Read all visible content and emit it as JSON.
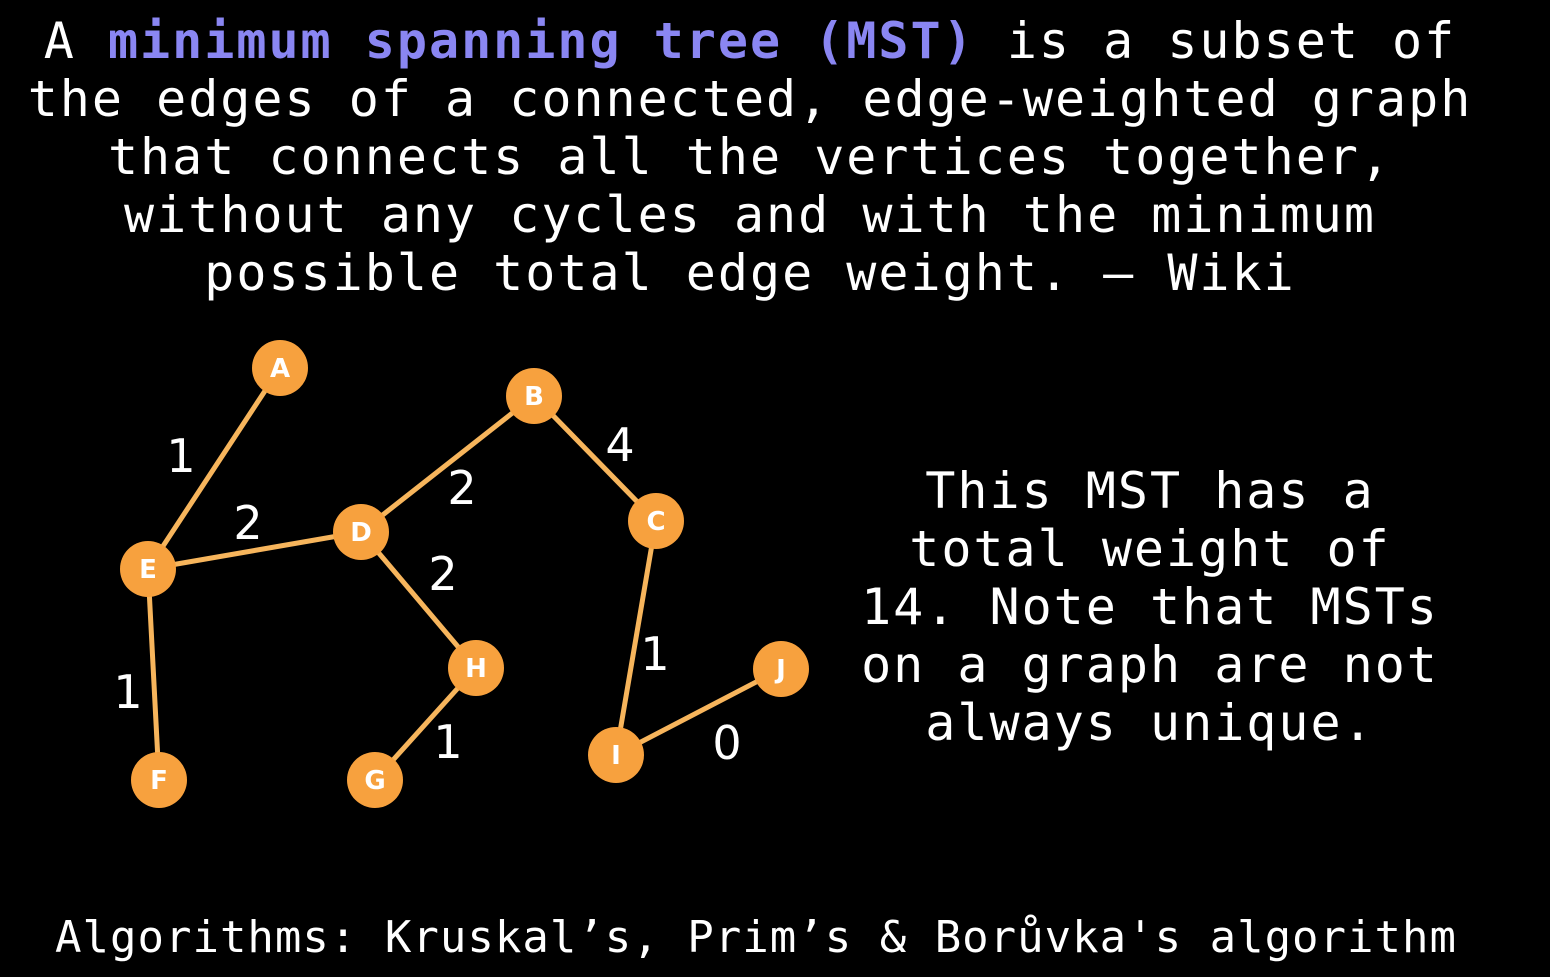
{
  "definition": {
    "line1_prefix": "A ",
    "line1_highlight": "minimum spanning tree (MST)",
    "line1_suffix": " is a subset of",
    "line2": "the edges of a connected, edge-weighted graph",
    "line3": "that connects all the vertices together,",
    "line4": "without any cycles and with the minimum",
    "line5": "possible total edge weight. – Wiki"
  },
  "note": {
    "line1": "This MST has a",
    "line2": "total weight of",
    "line3": "14. Note that MSTs",
    "line4": "on a graph are not",
    "line5": "always unique."
  },
  "footer": "Algorithms: Kruskal’s, Prim’s & Borůvka's algorithm",
  "colors": {
    "highlight": "#8a86f2",
    "node_fill": "#f7a13e",
    "edge": "#f7b55c",
    "background": "#000000"
  },
  "graph": {
    "nodes": [
      "A",
      "B",
      "C",
      "D",
      "E",
      "F",
      "G",
      "H",
      "I",
      "J"
    ],
    "edges": [
      {
        "from": "A",
        "to": "E",
        "weight": "1"
      },
      {
        "from": "E",
        "to": "D",
        "weight": "2"
      },
      {
        "from": "E",
        "to": "F",
        "weight": "1"
      },
      {
        "from": "D",
        "to": "B",
        "weight": "2"
      },
      {
        "from": "D",
        "to": "H",
        "weight": "2"
      },
      {
        "from": "B",
        "to": "C",
        "weight": "4"
      },
      {
        "from": "H",
        "to": "G",
        "weight": "1"
      },
      {
        "from": "C",
        "to": "I",
        "weight": "1"
      },
      {
        "from": "I",
        "to": "J",
        "weight": "0"
      }
    ]
  }
}
